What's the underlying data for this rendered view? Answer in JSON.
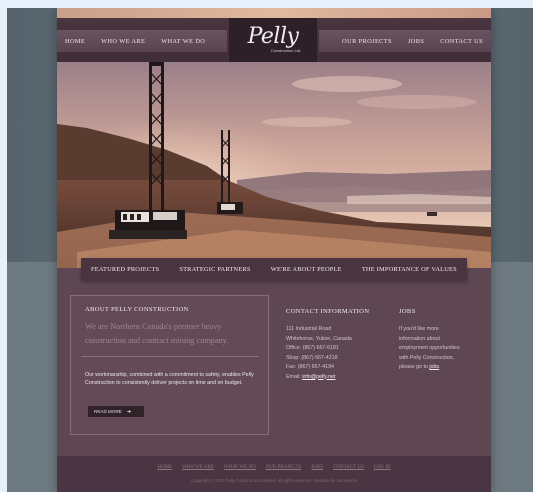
{
  "nav_left": [
    "HOME",
    "WHO WE ARE",
    "WHAT WE DO"
  ],
  "nav_right": [
    "OUR PROJECTS",
    "JOBS",
    "CONTACT US"
  ],
  "logo": {
    "name": "Pelly",
    "sub": "Construction Ltd."
  },
  "subnav": [
    "FEATURED PROJECTS",
    "STRATEGIC PARTNERS",
    "WE'RE ABOUT PEOPLE",
    "THE IMPORTANCE OF VALUES"
  ],
  "about": {
    "title": "ABOUT PELLY CONSTRUCTION",
    "tagline": "We are Northern Canada's premier heavy construction and contract mining company.",
    "body": "Our workmanship, combined with a commitment to safety, enables Pelly Construction to consistently deliver projects on time and on budget.",
    "read_more": "READ MORE"
  },
  "contact": {
    "title": "CONTACT INFORMATION",
    "lines": [
      "111 Industrial Road",
      "Whitehorse, Yukon, Canada",
      "Office: (867) 667-6181",
      "Shop: (867) 667-4218",
      "Fax: (867) 667-4194"
    ],
    "email_label": "Email:",
    "email": "info@pelly.net"
  },
  "jobs": {
    "title": "JOBS",
    "lines": [
      "If you'd like more",
      "information about",
      "employment opportunities",
      "with Pelly Construction,"
    ],
    "last_prefix": "please go to",
    "link": "jobs"
  },
  "footer_nav": [
    "HOME",
    "WHO WE ARE",
    "WHAT WE DO",
    "OUR PROJECTS",
    "JOBS",
    "CONTACT US",
    "LOG IN"
  ],
  "copyright": "Copyright © 2011 Pelly Construction Limited. All rights reserved. Website by Jamesxink",
  "colors": {
    "page": "#5e4752",
    "nav": "#3f2d37",
    "subnav": "#4a3440",
    "accent": "#8a6b78"
  }
}
